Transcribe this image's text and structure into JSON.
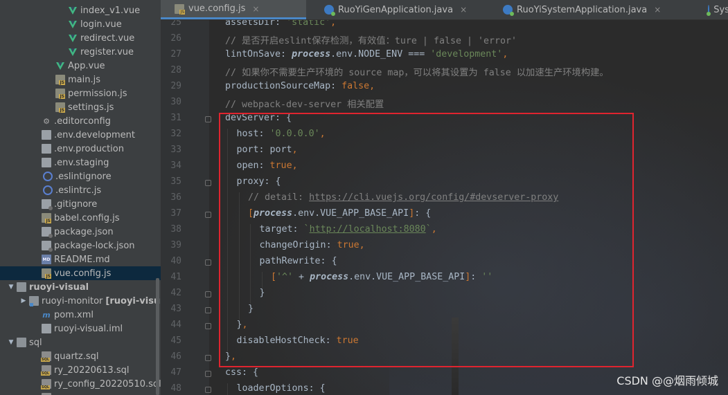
{
  "sidebar": {
    "items": [
      {
        "label": "index_v1.vue",
        "icon": "vue-icon",
        "indent": 100,
        "arrow": ""
      },
      {
        "label": "login.vue",
        "icon": "vue-icon",
        "indent": 100,
        "arrow": ""
      },
      {
        "label": "redirect.vue",
        "icon": "vue-icon",
        "indent": 100,
        "arrow": ""
      },
      {
        "label": "register.vue",
        "icon": "vue-icon",
        "indent": 100,
        "arrow": ""
      },
      {
        "label": "App.vue",
        "icon": "vue-icon",
        "indent": 82,
        "arrow": ""
      },
      {
        "label": "main.js",
        "icon": "js-file-icon",
        "indent": 82,
        "arrow": ""
      },
      {
        "label": "permission.js",
        "icon": "js-file-icon",
        "indent": 82,
        "arrow": ""
      },
      {
        "label": "settings.js",
        "icon": "js-file-icon",
        "indent": 82,
        "arrow": ""
      },
      {
        "label": ".editorconfig",
        "icon": "gear-icon",
        "indent": 62,
        "arrow": ""
      },
      {
        "label": ".env.development",
        "icon": "file-icon",
        "indent": 62,
        "arrow": ""
      },
      {
        "label": ".env.production",
        "icon": "file-icon",
        "indent": 62,
        "arrow": ""
      },
      {
        "label": ".env.staging",
        "icon": "file-icon",
        "indent": 62,
        "arrow": ""
      },
      {
        "label": ".eslintignore",
        "icon": "circle-icon",
        "indent": 62,
        "arrow": ""
      },
      {
        "label": ".eslintrc.js",
        "icon": "circle-icon",
        "indent": 62,
        "arrow": ""
      },
      {
        "label": ".gitignore",
        "icon": "locked-file-icon",
        "indent": 62,
        "arrow": ""
      },
      {
        "label": "babel.config.js",
        "icon": "js-file-icon",
        "indent": 62,
        "arrow": ""
      },
      {
        "label": "package.json",
        "icon": "locked-file-icon",
        "indent": 62,
        "arrow": ""
      },
      {
        "label": "package-lock.json",
        "icon": "locked-file-icon",
        "indent": 62,
        "arrow": ""
      },
      {
        "label": "README.md",
        "icon": "markdown-icon",
        "indent": 62,
        "arrow": ""
      },
      {
        "label": "vue.config.js",
        "icon": "js-file-icon",
        "indent": 62,
        "arrow": "",
        "selected": true
      },
      {
        "label": "ruoyi-visual",
        "icon": "folder-icon",
        "indent": 26,
        "arrow": "▼",
        "bold": true
      },
      {
        "label": "ruoyi-monitor",
        "extra": "[ruoyi-visu",
        "icon": "module-icon",
        "indent": 44,
        "arrow": "▶"
      },
      {
        "label": "pom.xml",
        "icon": "maven-icon",
        "indent": 62,
        "arrow": ""
      },
      {
        "label": "ruoyi-visual.iml",
        "icon": "iml-file-icon",
        "indent": 62,
        "arrow": ""
      },
      {
        "label": "sql",
        "icon": "folder-icon",
        "indent": 26,
        "arrow": "▼"
      },
      {
        "label": "quartz.sql",
        "icon": "sql-file-icon",
        "indent": 62,
        "arrow": ""
      },
      {
        "label": "ry_20220613.sql",
        "icon": "sql-file-icon",
        "indent": 62,
        "arrow": ""
      },
      {
        "label": "ry_config_20220510.sql",
        "icon": "sql-file-icon",
        "indent": 62,
        "arrow": ""
      },
      {
        "label": "ry_...",
        "icon": "sql-file-icon",
        "indent": 62,
        "arrow": ""
      }
    ]
  },
  "tabs": [
    {
      "label": "vue.config.js",
      "icon": "js-file-icon",
      "active": true,
      "close": "×"
    },
    {
      "label": "RuoYiGenApplication.java",
      "icon": "class-icon",
      "active": false,
      "close": "×"
    },
    {
      "label": "RuoYiSystemApplication.java",
      "icon": "class-icon",
      "active": false,
      "close": "×"
    },
    {
      "label": "SysC",
      "icon": "class-icon",
      "active": false,
      "close": ""
    }
  ],
  "editor": {
    "lines": [
      {
        "n": "25",
        "indent": 0,
        "tokens": [
          [
            "t-plain",
            "assetsDir: "
          ],
          [
            "t-str",
            "'static'"
          ],
          [
            "t-punc",
            ","
          ]
        ]
      },
      {
        "n": "26",
        "indent": 0,
        "tokens": [
          [
            "t-comment",
            "// 是否开启eslint保存检测，有效值：ture | false | 'error'"
          ]
        ]
      },
      {
        "n": "27",
        "indent": 0,
        "tokens": [
          [
            "t-plain",
            "lintOnSave: "
          ],
          [
            "t-obj",
            "process"
          ],
          [
            "t-plain",
            ".env.NODE_ENV "
          ],
          [
            "t-plain",
            "=== "
          ],
          [
            "t-str",
            "'development'"
          ],
          [
            "t-punc",
            ","
          ]
        ]
      },
      {
        "n": "28",
        "indent": 0,
        "tokens": [
          [
            "t-comment",
            "// 如果你不需要生产环境的 source map，可以将其设置为 false 以加速生产环境构建。"
          ]
        ]
      },
      {
        "n": "29",
        "indent": 0,
        "tokens": [
          [
            "t-plain",
            "productionSourceMap: "
          ],
          [
            "t-key",
            "false"
          ],
          [
            "t-punc",
            ","
          ]
        ]
      },
      {
        "n": "30",
        "indent": 0,
        "tokens": [
          [
            "t-comment",
            "// webpack-dev-server 相关配置"
          ]
        ]
      },
      {
        "n": "31",
        "indent": 0,
        "fold": true,
        "tokens": [
          [
            "t-plain",
            "devServer: {"
          ]
        ]
      },
      {
        "n": "32",
        "indent": 1,
        "tokens": [
          [
            "t-plain",
            "host: "
          ],
          [
            "t-str",
            "'0.0.0.0'"
          ],
          [
            "t-punc",
            ","
          ]
        ]
      },
      {
        "n": "33",
        "indent": 1,
        "tokens": [
          [
            "t-plain",
            "port: port"
          ],
          [
            "t-punc",
            ","
          ]
        ]
      },
      {
        "n": "34",
        "indent": 1,
        "tokens": [
          [
            "t-plain",
            "open: "
          ],
          [
            "t-key",
            "true"
          ],
          [
            "t-punc",
            ","
          ]
        ]
      },
      {
        "n": "35",
        "indent": 1,
        "fold": true,
        "tokens": [
          [
            "t-plain",
            "proxy: {"
          ]
        ]
      },
      {
        "n": "36",
        "indent": 2,
        "tokens": [
          [
            "t-comment",
            "// detail: "
          ],
          [
            "t-url",
            "https://cli.vuejs.org/config/#devserver-proxy"
          ]
        ]
      },
      {
        "n": "37",
        "indent": 2,
        "fold": true,
        "tokens": [
          [
            "t-punc",
            "["
          ],
          [
            "t-obj",
            "process"
          ],
          [
            "t-plain",
            ".env.VUE_APP_BASE_API"
          ],
          [
            "t-punc",
            "]"
          ],
          [
            "t-plain",
            ": {"
          ]
        ]
      },
      {
        "n": "38",
        "indent": 3,
        "tokens": [
          [
            "t-plain",
            "target: "
          ],
          [
            "t-str",
            "`"
          ],
          [
            "t-link",
            "http://localhost:8080"
          ],
          [
            "t-str",
            "`"
          ],
          [
            "t-punc",
            ","
          ]
        ]
      },
      {
        "n": "39",
        "indent": 3,
        "tokens": [
          [
            "t-plain",
            "changeOrigin: "
          ],
          [
            "t-key",
            "true"
          ],
          [
            "t-punc",
            ","
          ]
        ]
      },
      {
        "n": "40",
        "indent": 3,
        "fold": true,
        "tokens": [
          [
            "t-plain",
            "pathRewrite: {"
          ]
        ]
      },
      {
        "n": "41",
        "indent": 4,
        "tokens": [
          [
            "t-punc",
            "["
          ],
          [
            "t-str",
            "'^'"
          ],
          [
            "t-plain",
            " + "
          ],
          [
            "t-obj",
            "process"
          ],
          [
            "t-plain",
            ".env.VUE_APP_BASE_API"
          ],
          [
            "t-punc",
            "]"
          ],
          [
            "t-plain",
            ": "
          ],
          [
            "t-str",
            "''"
          ]
        ]
      },
      {
        "n": "42",
        "indent": 3,
        "fold": true,
        "tokens": [
          [
            "t-plain",
            "}"
          ]
        ]
      },
      {
        "n": "43",
        "indent": 2,
        "fold": true,
        "tokens": [
          [
            "t-plain",
            "}"
          ]
        ]
      },
      {
        "n": "44",
        "indent": 1,
        "fold": true,
        "tokens": [
          [
            "t-plain",
            "}"
          ],
          [
            "t-punc",
            ","
          ]
        ]
      },
      {
        "n": "45",
        "indent": 1,
        "tokens": [
          [
            "t-plain",
            "disableHostCheck: "
          ],
          [
            "t-key",
            "true"
          ]
        ]
      },
      {
        "n": "46",
        "indent": 0,
        "fold": true,
        "tokens": [
          [
            "t-plain",
            "}"
          ],
          [
            "t-punc",
            ","
          ]
        ]
      },
      {
        "n": "47",
        "indent": 0,
        "fold": true,
        "tokens": [
          [
            "t-plain",
            "css: {"
          ]
        ]
      },
      {
        "n": "48",
        "indent": 1,
        "fold": true,
        "tokens": [
          [
            "t-plain",
            "loaderOptions: {"
          ]
        ]
      }
    ]
  },
  "watermark": "CSDN @@烟雨倾城",
  "colors": {
    "highlight_box": "#e0242f",
    "accent": "#4a88c7",
    "selection": "#0d293e"
  }
}
